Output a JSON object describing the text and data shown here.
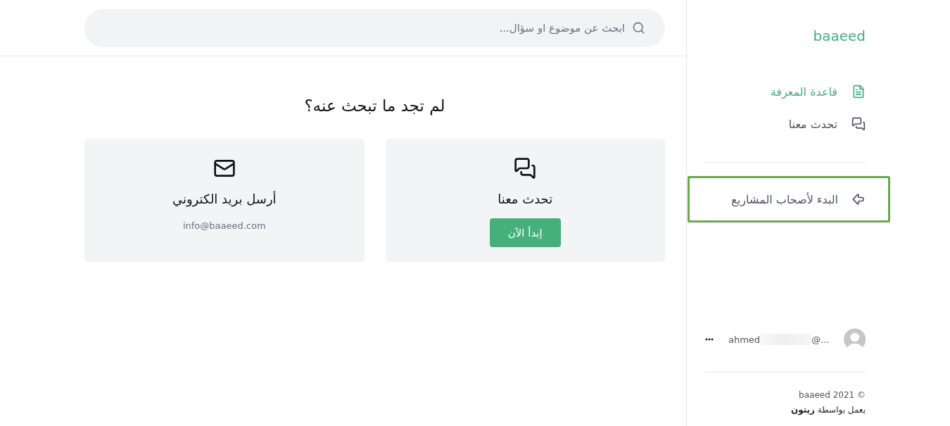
{
  "sidebar": {
    "logo": "baaeed",
    "nav": [
      {
        "kind": "document",
        "label": "قاعدة المعرفة",
        "selected": true
      },
      {
        "kind": "chat",
        "label": "تحدث معنا",
        "selected": false
      }
    ],
    "project_link": {
      "label": "البدء لأصحاب المشاريع",
      "highlighted": true
    },
    "user": {
      "email_prefix": "ahmed",
      "email_suffix": "@..."
    },
    "footer": {
      "copyright": "© baaeed 2021",
      "powered_by": "يعمل بواسطة **زيتون**"
    }
  },
  "search": {
    "placeholder": "ابحث عن موضوع او سؤال..."
  },
  "help": {
    "title": "لم تجد ما تبحث عنه؟",
    "cards": [
      {
        "kind": "chat",
        "title": "تحدث معنا",
        "button": "إبدأ الآن"
      },
      {
        "kind": "email",
        "title": "أرسل بريد الكتروني",
        "email": "info@baaeed.com"
      }
    ]
  }
}
